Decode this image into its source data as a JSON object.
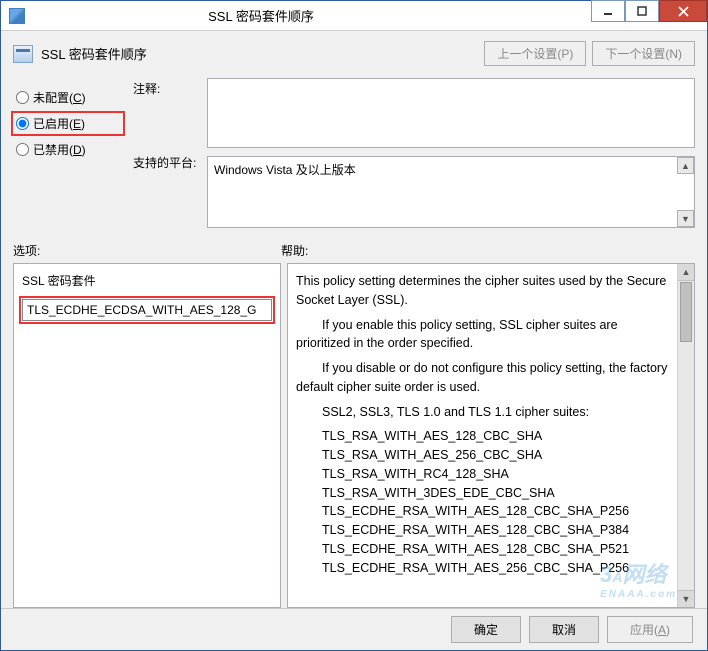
{
  "window": {
    "title": "SSL 密码套件顺序"
  },
  "header": {
    "title": "SSL 密码套件顺序",
    "prev": "上一个设置(P)",
    "next": "下一个设置(N)"
  },
  "radios": {
    "not_configured_pre": "未配置(",
    "not_configured_key": "C",
    "enabled_pre": "已启用(",
    "enabled_key": "E",
    "disabled_pre": "已禁用(",
    "disabled_key": "D",
    "suffix": ")"
  },
  "labels": {
    "comment": "注释:",
    "platform": "支持的平台:",
    "options": "选项:",
    "help": "帮助:"
  },
  "fields": {
    "comment_value": "",
    "platform_value": "Windows Vista 及以上版本"
  },
  "options_panel": {
    "title": "SSL 密码套件",
    "cipher_value": "TLS_ECDHE_ECDSA_WITH_AES_128_G"
  },
  "help": {
    "p1": "This policy setting determines the cipher suites used by the Secure Socket Layer (SSL).",
    "p2": "If you enable this policy setting, SSL cipher suites are prioritized in the order specified.",
    "p3": "If you disable or do not configure this policy setting, the factory default cipher suite order is used.",
    "p4": "SSL2, SSL3, TLS 1.0 and TLS 1.1 cipher suites:",
    "ciphers": [
      "TLS_RSA_WITH_AES_128_CBC_SHA",
      "TLS_RSA_WITH_AES_256_CBC_SHA",
      "TLS_RSA_WITH_RC4_128_SHA",
      "TLS_RSA_WITH_3DES_EDE_CBC_SHA",
      "TLS_ECDHE_RSA_WITH_AES_128_CBC_SHA_P256",
      "TLS_ECDHE_RSA_WITH_AES_128_CBC_SHA_P384",
      "TLS_ECDHE_RSA_WITH_AES_128_CBC_SHA_P521",
      "TLS_ECDHE_RSA_WITH_AES_256_CBC_SHA_P256"
    ]
  },
  "footer": {
    "ok": "确定",
    "cancel": "取消",
    "apply_pre": "应用(",
    "apply_key": "A",
    "apply_suf": ")"
  }
}
